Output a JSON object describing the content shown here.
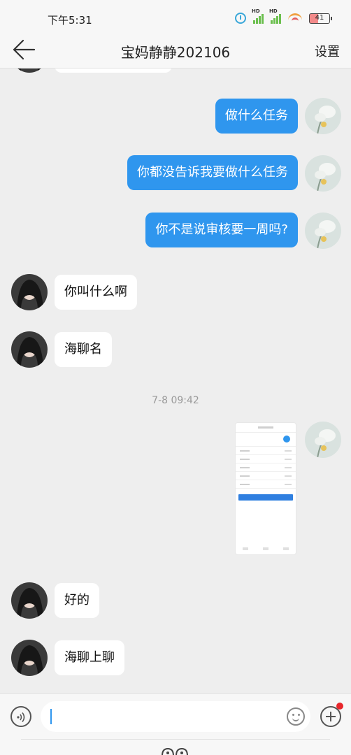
{
  "status_bar": {
    "time": "下午5:31",
    "hd1": "HD",
    "hd2": "HD",
    "battery": "41"
  },
  "header": {
    "title": "宝妈静静202106",
    "settings_label": "设置"
  },
  "messages": [
    {
      "side": "me",
      "text": "做什么任务"
    },
    {
      "side": "me",
      "text": "你都没告诉我要做什么任务"
    },
    {
      "side": "me",
      "text": "你不是说审核要一周吗?"
    },
    {
      "side": "them",
      "text": "你叫什么啊"
    },
    {
      "side": "them",
      "text": "海聊名"
    },
    {
      "side": "me",
      "type": "image"
    },
    {
      "side": "them",
      "text": "好的"
    },
    {
      "side": "them",
      "text": "海聊上聊"
    }
  ],
  "timestamp": "7-8 09:42",
  "input": {
    "value": ""
  },
  "colors": {
    "accent": "#2f96ee",
    "background": "#eeeeee",
    "notify_dot": "#e8262b"
  },
  "icons": [
    "back-arrow-icon",
    "voice-icon",
    "emoji-icon",
    "plus-icon",
    "clock-icon",
    "wifi-icon",
    "battery-icon"
  ]
}
